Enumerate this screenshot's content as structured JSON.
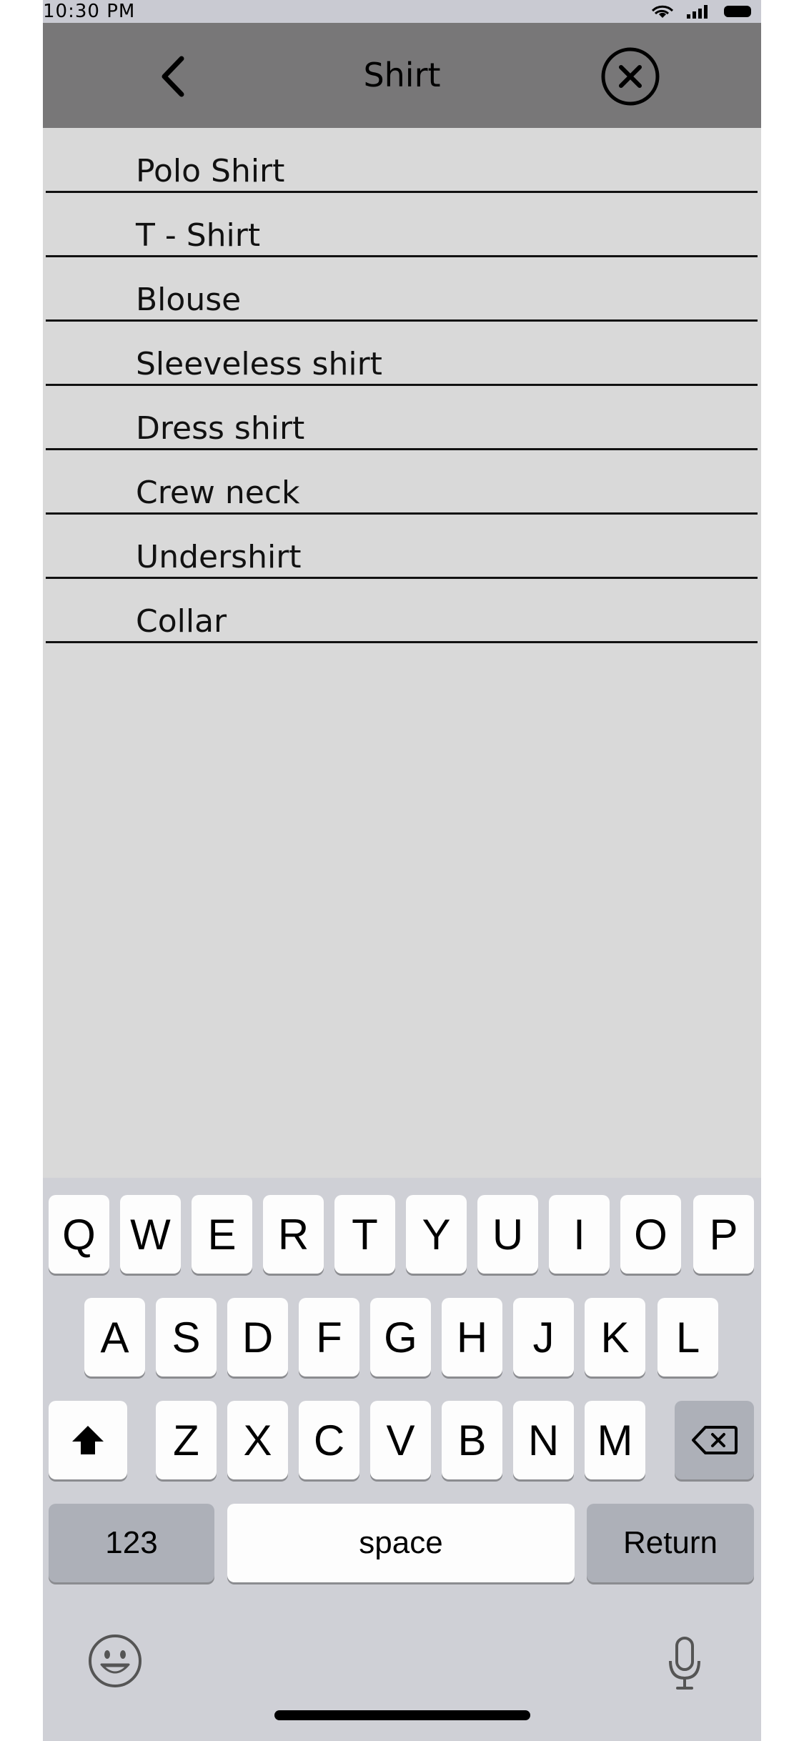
{
  "status_bar": {
    "time": "10:30 PM"
  },
  "header": {
    "title": "Shirt"
  },
  "list": {
    "items": [
      "Polo Shirt",
      "T - Shirt",
      "Blouse",
      "Sleeveless shirt",
      "Dress shirt",
      "Crew neck",
      "Undershirt",
      "Collar"
    ]
  },
  "keyboard": {
    "row1": [
      "Q",
      "W",
      "E",
      "R",
      "T",
      "Y",
      "U",
      "I",
      "O",
      "P"
    ],
    "row2": [
      "A",
      "S",
      "D",
      "F",
      "G",
      "H",
      "J",
      "K",
      "L"
    ],
    "row3": [
      "Z",
      "X",
      "C",
      "V",
      "B",
      "N",
      "M"
    ],
    "numbers_label": "123",
    "space_label": "space",
    "return_label": "Return"
  },
  "icons": {
    "back": "chevron-left-icon",
    "close": "close-circle-icon",
    "shift": "shift-icon",
    "backspace": "backspace-icon",
    "emoji": "emoji-icon",
    "mic": "microphone-icon"
  },
  "colors": {
    "header_bg": "#787778",
    "content_bg": "#d9d9d9",
    "keyboard_bg": "#cfd0d6"
  }
}
